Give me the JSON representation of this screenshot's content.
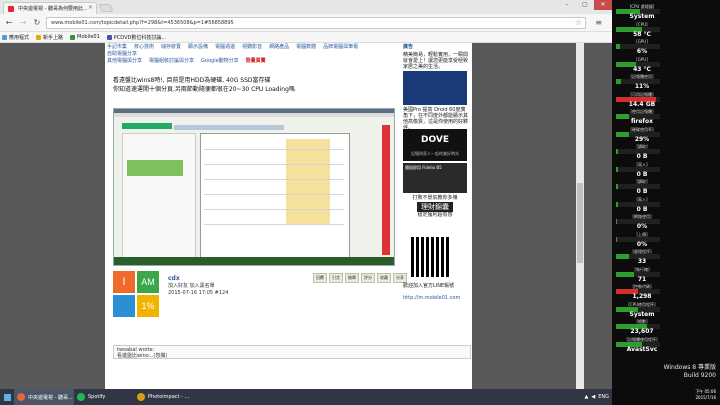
{
  "browser": {
    "tab_title": "中央遊電視 - 聽哥為何要用此...",
    "url": "www.mobile01.com/topicdetail.php?f=298&t=4536508&p=1#56858895",
    "window_controls": [
      "–",
      "▢",
      "✕"
    ],
    "bookmarks": [
      {
        "label": "應用程式",
        "color": "#5b9bd5"
      },
      {
        "label": "新手上路",
        "color": "#e0b000"
      },
      {
        "label": "Mobile01",
        "color": "#3a8f3a"
      },
      {
        "label": "PCDVD數位科技討論...",
        "color": "#5050a0"
      }
    ]
  },
  "forum": {
    "nav_row1": [
      "手記市集",
      "核心技術",
      "儲存裝置",
      "顯示設備",
      "電腦週邊",
      "視聽影音",
      "網路產品",
      "電腦軟體",
      "品牌電腦與筆電",
      "自助電腦分享"
    ],
    "nav_row2": [
      "其他電腦與分享",
      "電腦組裝討論與分享",
      "Google動物分享"
    ],
    "nav_hot": "限量買賣",
    "headline_1": "看遠盤比wins8時!, 目前是用HDD為硬碟, 40G SSD當存碟",
    "headline_2": "你知道速運開十個分頁,另兩節動隨便都很在20~30 CPU Loading嗎",
    "avatar_cells": [
      {
        "text": "I",
        "color": "#f06b2a"
      },
      {
        "text": "AM",
        "color": "#3aa848"
      },
      {
        "text": "",
        "color": "#2b8fd6"
      },
      {
        "text": "1%",
        "color": "#f0b400"
      }
    ],
    "author": "cdx",
    "author_meta_1": "加入好友  加入黑名單",
    "author_meta_2": "2015-07-16 17:05  #124",
    "actions": [
      "回覆",
      "引言",
      "檢舉",
      "評分",
      "收藏",
      "分享"
    ],
    "quote_author": "twoabal wrote:",
    "quote_text": "看進盤比wino...(恕擷)",
    "sidebar_title": "廣告",
    "sidebar_text_1": "精美簡易，輕鬆實用，一瞬間就會愛上！讓您更能享受極致家居之美的生活。",
    "sidebar_text_2": "美國Pro 提高 Droid 60度廣角下，在不同度外都能顯示其他高像質，這是你使用的好夥伴。",
    "sidebar_ad_1": "DOVE",
    "sidebar_ad_1_sub": "記憶與家人一起的美好時光",
    "sidebar_ad_2": "隨插即用 Fidelio B5",
    "sidebar_ad_3_title": "打敗不景氣教你多賺",
    "sidebar_ad_3_sub": "理財錦囊",
    "sidebar_ad_3_foot": "穩定獲利超有感",
    "sidebar_qr_text": "歡迎加入官方LINE帳號",
    "sidebar_qr_url": "http://m.mobile01.com"
  },
  "taskbar": {
    "items": [
      {
        "label": "中央遊電視 - 聽哥...",
        "color": "#e8663a",
        "active": true
      },
      {
        "label": "Spotify",
        "color": "#1db954",
        "active": false
      },
      {
        "label": "Photoimpact - ...",
        "color": "#d4a017",
        "active": false
      }
    ],
    "tray_lang": "ENG"
  },
  "gadgets": {
    "metrics": [
      {
        "label": "[CPU 處理器]",
        "value": "System",
        "bar": 0.55,
        "color": "#2f9e2f"
      },
      {
        "label": "[CPU]",
        "value": "58 °C",
        "bar": 0.6,
        "color": "#2f9e2f"
      },
      {
        "label": "[GPU]",
        "value": "6%",
        "bar": 0.1,
        "color": "#2f9e2f"
      },
      {
        "label": "[GPU]",
        "value": "43 °C",
        "bar": 0.45,
        "color": "#2f9e2f"
      },
      {
        "label": "[記憶體使用]",
        "value": "11%",
        "bar": 0.11,
        "color": "#2f9e2f"
      },
      {
        "label": "[可用記憶體]",
        "value": "14.4 GB",
        "bar": 0.9,
        "color": "#d42f2f"
      },
      {
        "label": "[使用記憶體]",
        "value": "firefox",
        "bar": 0.3,
        "color": "#2f9e2f"
      },
      {
        "label": "[硬碟使用率]",
        "value": "29%",
        "bar": 0.29,
        "color": "#2f9e2f"
      },
      {
        "label": "[讀取]",
        "value": "0 B",
        "bar": 0.05,
        "color": "#2f9e2f"
      },
      {
        "label": "[寫入]",
        "value": "0 B",
        "bar": 0.05,
        "color": "#2f9e2f"
      },
      {
        "label": "[讀取]",
        "value": "0 B",
        "bar": 0.05,
        "color": "#2f9e2f"
      },
      {
        "label": "[寫入]",
        "value": "0 B",
        "bar": 0.05,
        "color": "#2f9e2f"
      },
      {
        "label": "[網路使用]",
        "value": "0%",
        "bar": 0.02,
        "color": "#2f9e2f"
      },
      {
        "label": "[上傳]",
        "value": "0%",
        "bar": 0.02,
        "color": "#2f9e2f"
      },
      {
        "label": "[處理程序]",
        "value": "33",
        "bar": 0.3,
        "color": "#2f9e2f"
      },
      {
        "label": "[執行緒]",
        "value": "71",
        "bar": 0.4,
        "color": "#2f9e2f"
      },
      {
        "label": "[控制代碼]",
        "value": "1,298",
        "bar": 0.5,
        "color": "#d42f2f"
      },
      {
        "label": "[CPU使用程序]",
        "value": "System",
        "bar": 0.5,
        "color": "#2f9e2f"
      },
      {
        "label": "[總數]",
        "value": "23,607",
        "bar": 0.7,
        "color": "#2f9e2f"
      },
      {
        "label": "[記憶體使用程序]",
        "value": "AvastSvc",
        "bar": 0.6,
        "color": "#2f9e2f"
      }
    ],
    "os_name": "Windows 8 專業版",
    "os_build": "Build 9200",
    "clock_time": "下午 05:06",
    "clock_date": "2015/7/16"
  }
}
